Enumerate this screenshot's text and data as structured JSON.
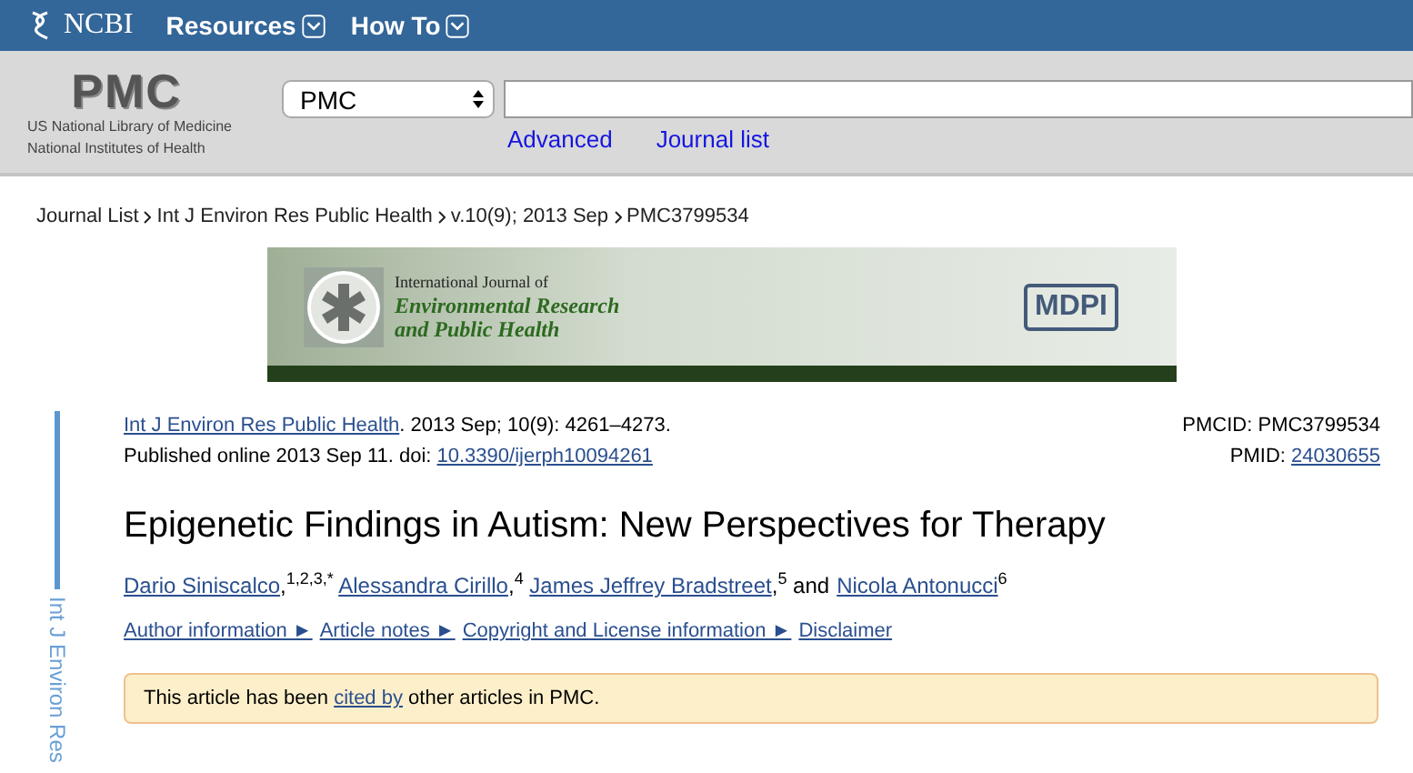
{
  "topbar": {
    "brand": "NCBI",
    "menus": [
      {
        "label": "Resources"
      },
      {
        "label": "How To"
      }
    ]
  },
  "header": {
    "logo": "PMC",
    "org_lines": [
      "US National Library of Medicine",
      "National Institutes of Health"
    ],
    "database_select": "PMC",
    "links": [
      "Advanced",
      "Journal list"
    ]
  },
  "breadcrumb": [
    "Journal List",
    "Int J Environ Res Public Health",
    "v.10(9); 2013 Sep",
    "PMC3799534"
  ],
  "banner": {
    "journal_lines": [
      "International Journal of",
      "Environmental Research",
      "and Public Health"
    ],
    "publisher_logo": "MDPI"
  },
  "side_label": "Int J Environ Res",
  "citation": {
    "journal_link": "Int J Environ Res Public Health",
    "details": ". 2013 Sep; 10(9): 4261–4273.",
    "published": "Published online 2013 Sep 11. doi: ",
    "doi": "10.3390/ijerph10094261",
    "pmcid": "PMCID: PMC3799534",
    "pmid_label": "PMID: ",
    "pmid": "24030655"
  },
  "title": "Epigenetic Findings in Autism: New Perspectives for Therapy",
  "authors": [
    {
      "name": "Dario Siniscalco",
      "punct": ",",
      "marks": "1,2,3,*"
    },
    {
      "name": "Alessandra Cirillo",
      "punct": ",",
      "marks": "4"
    },
    {
      "name": "James Jeffrey Bradstreet",
      "punct": ",",
      "marks": "5"
    },
    {
      "name": "Nicola Antonucci",
      "marks": "6",
      "connector": "and"
    }
  ],
  "info_links": [
    "Author information ►",
    "Article notes ►",
    "Copyright and License information ►",
    "Disclaimer"
  ],
  "notice": {
    "before": "This article has been ",
    "link": "cited by",
    "after": " other articles in PMC."
  }
}
